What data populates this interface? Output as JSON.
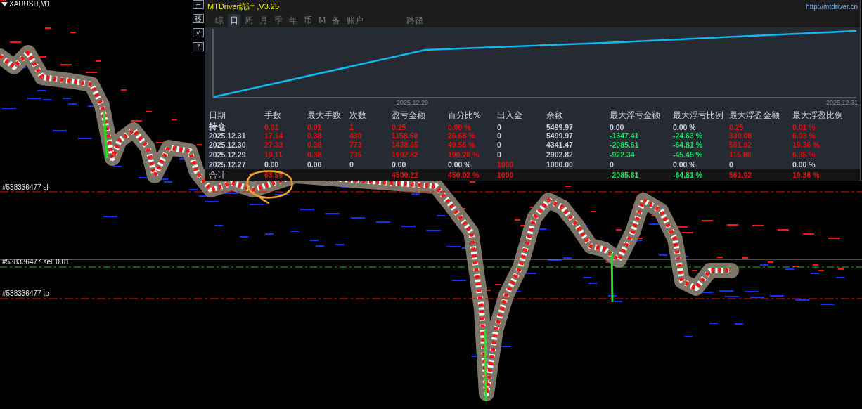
{
  "chart": {
    "title": "XAUUSD,M1",
    "order_lines": [
      {
        "label": "#538336477 sl",
        "kind": "sl"
      },
      {
        "label": "#538336477 sell 0.01",
        "kind": "entry"
      },
      {
        "label": "#538336477 tp",
        "kind": "tp"
      }
    ]
  },
  "side_buttons": [
    "−",
    "移",
    "√",
    "?"
  ],
  "panel": {
    "title": "MTDriver统计 ,V3.25",
    "link": "http://mtdriver.cn",
    "tabs": [
      {
        "label": "综",
        "selected": false
      },
      {
        "label": "日",
        "selected": true
      },
      {
        "label": "周",
        "selected": false
      },
      {
        "label": "月",
        "selected": false
      },
      {
        "label": "季",
        "selected": false
      },
      {
        "label": "年",
        "selected": false
      },
      {
        "label": "币",
        "selected": false
      },
      {
        "label": "M",
        "selected": false
      },
      {
        "label": "备",
        "selected": false
      },
      {
        "label": "账户",
        "selected": false
      }
    ],
    "path_tab": "路径",
    "curve_dates": [
      "2025.12.29",
      "2025.12.31"
    ],
    "table": {
      "columns": [
        "日期",
        "手数",
        "最大手数",
        "次数",
        "盈亏金额",
        "百分比%",
        "出入金",
        "余额",
        "最大浮亏金额",
        "最大浮亏比例",
        "最大浮盈金额",
        "最大浮盈比例"
      ],
      "rows": [
        {
          "cells": [
            {
              "text": "持仓",
              "color": "#c8d0dc"
            },
            {
              "text": "0.01",
              "color": "#e01010"
            },
            {
              "text": "0.01",
              "color": "#e01010"
            },
            {
              "text": "1",
              "color": "#e01010"
            },
            {
              "text": "0.25",
              "color": "#e01010"
            },
            {
              "text": "0.00 %",
              "color": "#e01010"
            },
            {
              "text": "0",
              "color": "#c8d0dc"
            },
            {
              "text": "5499.97",
              "color": "#c8d0dc"
            },
            {
              "text": "0.00",
              "color": "#c8d0dc"
            },
            {
              "text": "0.00 %",
              "color": "#c8d0dc"
            },
            {
              "text": "0.25",
              "color": "#e01010"
            },
            {
              "text": "0.01 %",
              "color": "#e01010"
            }
          ]
        },
        {
          "cells": [
            {
              "text": "2025.12.31",
              "color": "#c8d0dc"
            },
            {
              "text": "17.14",
              "color": "#e01010"
            },
            {
              "text": "0.38",
              "color": "#e01010"
            },
            {
              "text": "430",
              "color": "#e01010"
            },
            {
              "text": "1158.50",
              "color": "#e01010"
            },
            {
              "text": "26.68 %",
              "color": "#e01010"
            },
            {
              "text": "0",
              "color": "#c8d0dc"
            },
            {
              "text": "5499.97",
              "color": "#c8d0dc"
            },
            {
              "text": "-1347.41",
              "color": "#22dd66"
            },
            {
              "text": "-24.63 %",
              "color": "#22dd66"
            },
            {
              "text": "330.08",
              "color": "#e01010"
            },
            {
              "text": "6.03 %",
              "color": "#e01010"
            }
          ]
        },
        {
          "cells": [
            {
              "text": "2025.12.30",
              "color": "#c8d0dc"
            },
            {
              "text": "27.33",
              "color": "#e01010"
            },
            {
              "text": "0.38",
              "color": "#e01010"
            },
            {
              "text": "773",
              "color": "#e01010"
            },
            {
              "text": "1438.65",
              "color": "#e01010"
            },
            {
              "text": "49.56 %",
              "color": "#e01010"
            },
            {
              "text": "0",
              "color": "#c8d0dc"
            },
            {
              "text": "4341.47",
              "color": "#c8d0dc"
            },
            {
              "text": "-2085.61",
              "color": "#22dd66"
            },
            {
              "text": "-64.81 %",
              "color": "#22dd66"
            },
            {
              "text": "561.92",
              "color": "#e01010"
            },
            {
              "text": "19.36 %",
              "color": "#e01010"
            }
          ]
        },
        {
          "cells": [
            {
              "text": "2025.12.29",
              "color": "#c8d0dc"
            },
            {
              "text": "19.11",
              "color": "#e01010"
            },
            {
              "text": "0.38",
              "color": "#e01010"
            },
            {
              "text": "735",
              "color": "#e01010"
            },
            {
              "text": "1902.82",
              "color": "#e01010"
            },
            {
              "text": "190.28 %",
              "color": "#e01010"
            },
            {
              "text": "0",
              "color": "#c8d0dc"
            },
            {
              "text": "2902.82",
              "color": "#c8d0dc"
            },
            {
              "text": "-922.34",
              "color": "#22dd66"
            },
            {
              "text": "-45.45 %",
              "color": "#22dd66"
            },
            {
              "text": "115.86",
              "color": "#e01010"
            },
            {
              "text": "6.35 %",
              "color": "#e01010"
            }
          ]
        },
        {
          "cells": [
            {
              "text": "2025.12.27",
              "color": "#c8d0dc"
            },
            {
              "text": "0.00",
              "color": "#c8d0dc"
            },
            {
              "text": "0.00",
              "color": "#c8d0dc"
            },
            {
              "text": "0",
              "color": "#c8d0dc"
            },
            {
              "text": "0.00",
              "color": "#c8d0dc"
            },
            {
              "text": "0.00 %",
              "color": "#c8d0dc"
            },
            {
              "text": "1000",
              "color": "#e01010"
            },
            {
              "text": "1000.00",
              "color": "#c8d0dc"
            },
            {
              "text": "0",
              "color": "#c8d0dc"
            },
            {
              "text": "0.00 %",
              "color": "#c8d0dc"
            },
            {
              "text": "0",
              "color": "#c8d0dc"
            },
            {
              "text": "0.00 %",
              "color": "#c8d0dc"
            }
          ]
        }
      ],
      "total": {
        "label": "合计",
        "cells": [
          {
            "text": "63.59",
            "color": "#e01010"
          },
          null,
          null,
          {
            "text": "4500.22",
            "color": "#e01010"
          },
          {
            "text": "450.02 %",
            "color": "#e01010"
          },
          {
            "text": "1000",
            "color": "#e01010"
          },
          null,
          {
            "text": "-2085.61",
            "color": "#22dd66"
          },
          {
            "text": "-64.81 %",
            "color": "#22dd66"
          },
          {
            "text": "561.92",
            "color": "#e01010"
          },
          {
            "text": "19.36 %",
            "color": "#e01010"
          }
        ]
      }
    }
  }
}
